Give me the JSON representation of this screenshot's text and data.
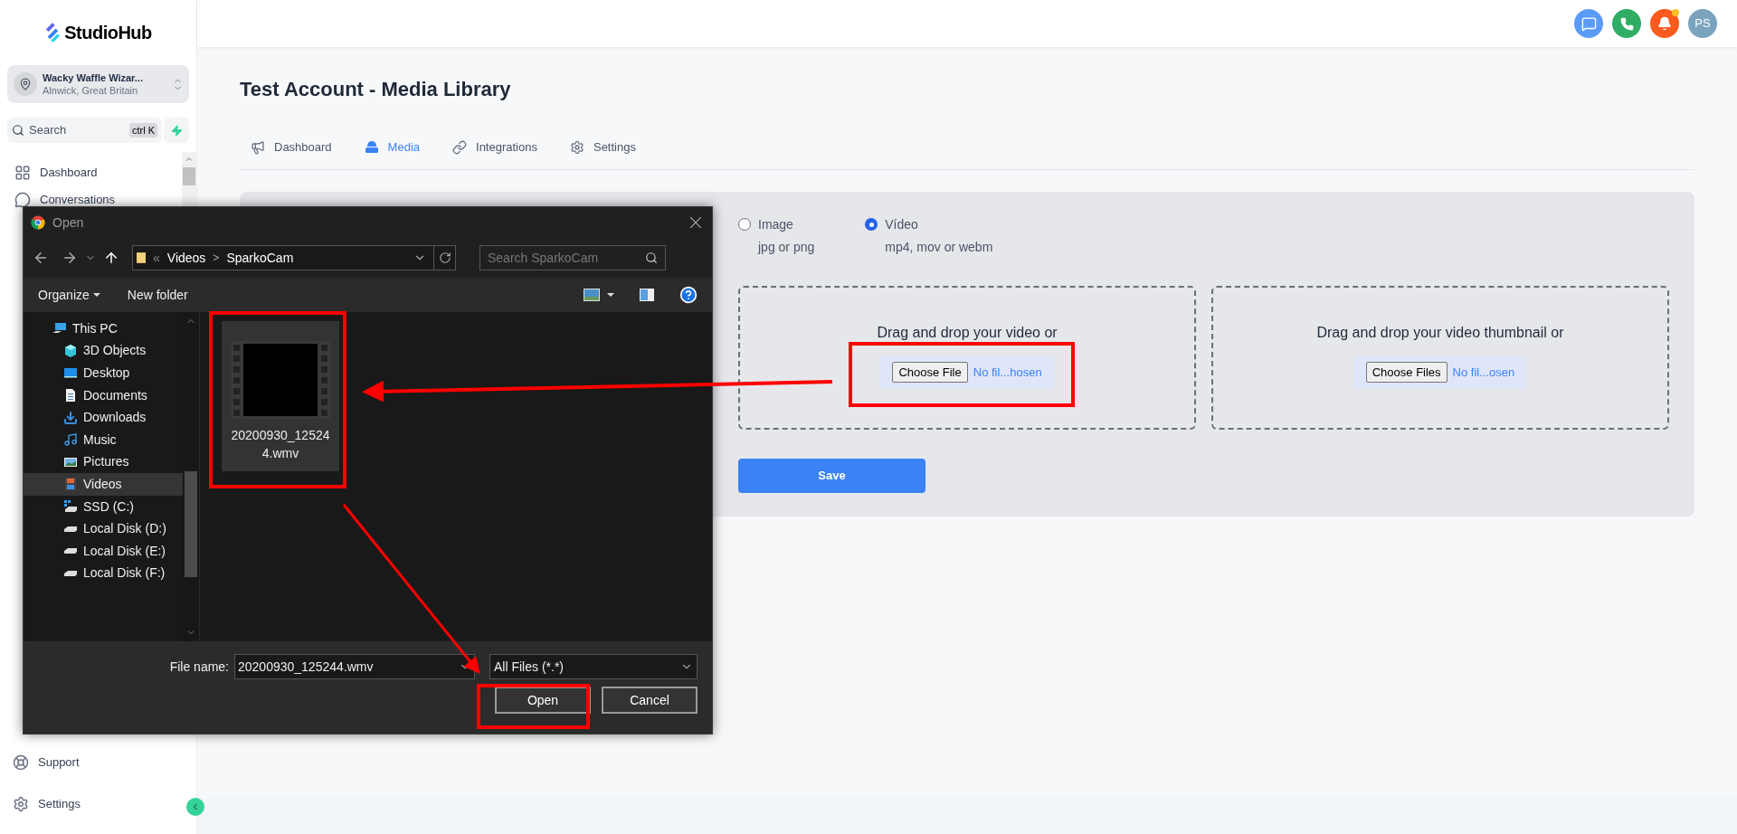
{
  "app": {
    "logo": "StudioHub"
  },
  "account": {
    "name": "Wacky Waffle Wizar...",
    "location": "Alnwick, Great Britain"
  },
  "search": {
    "placeholder": "Search",
    "shortcut": "ctrl K"
  },
  "sidebar": {
    "items": [
      {
        "kind": "grid",
        "label": "Dashboard"
      },
      {
        "kind": "chat",
        "label": "Conversations"
      }
    ],
    "bottom_items": [
      {
        "kind": "support",
        "label": "Support"
      },
      {
        "kind": "settings",
        "label": "Settings"
      }
    ]
  },
  "header": {
    "avatar": "PS",
    "notification_dot": true
  },
  "page": {
    "title": "Test Account - Media Library"
  },
  "tabs": [
    {
      "kind": "megaphone",
      "label": "Dashboard",
      "selected": false
    },
    {
      "kind": "media",
      "label": "Media",
      "selected": true
    },
    {
      "kind": "link",
      "label": "Integrations",
      "selected": false
    },
    {
      "kind": "settings",
      "label": "Settings",
      "selected": false
    }
  ],
  "media_types": [
    {
      "label": "Image",
      "hint": "jpg or png",
      "selected": false
    },
    {
      "label": "Vídeo",
      "hint": "mp4, mov or webm",
      "selected": true
    }
  ],
  "dropzones": [
    {
      "text": "Drag and drop your video or",
      "button": "Choose File",
      "status": "No fil...hosen",
      "annotated": true
    },
    {
      "text": "Drag and drop your video thumbnail or",
      "button": "Choose Files",
      "status": "No fil...osen",
      "annotated": false
    }
  ],
  "save_button": "Save",
  "dialog": {
    "title": "Open",
    "overflow": "«",
    "path": [
      "Videos",
      "SparkoCam"
    ],
    "path_separator": ">",
    "search_placeholder": "Search SparkoCam",
    "toolbar": [
      "Organize",
      "New folder"
    ],
    "nav": [
      {
        "kind": "pc",
        "label": "This PC",
        "selected": false,
        "children": [
          {
            "kind": "cube",
            "label": "3D Objects",
            "selected": false
          },
          {
            "kind": "desktop",
            "label": "Desktop",
            "selected": false
          },
          {
            "kind": "document",
            "label": "Documents",
            "selected": false
          },
          {
            "kind": "download",
            "label": "Downloads",
            "selected": false
          },
          {
            "kind": "music",
            "label": "Music",
            "selected": false
          },
          {
            "kind": "pictures",
            "label": "Pictures",
            "selected": false
          },
          {
            "kind": "videos",
            "label": "Videos",
            "selected": true
          },
          {
            "kind": "system-drive",
            "label": "SSD (C:)",
            "selected": false
          },
          {
            "kind": "drive",
            "label": "Local Disk (D:)",
            "selected": false
          },
          {
            "kind": "drive",
            "label": "Local Disk (E:)",
            "selected": false
          },
          {
            "kind": "drive",
            "label": "Local Disk (F:)",
            "selected": false
          }
        ]
      }
    ],
    "files": [
      {
        "name": "20200930_125244.wmv",
        "selected": true,
        "annotated": true
      }
    ],
    "file_name_label": "File name:",
    "file_name": "20200930_125244.wmv",
    "file_type": "All Files (*.*)",
    "open_button": {
      "label": "Open",
      "annotated": true
    },
    "cancel_button": "Cancel"
  }
}
